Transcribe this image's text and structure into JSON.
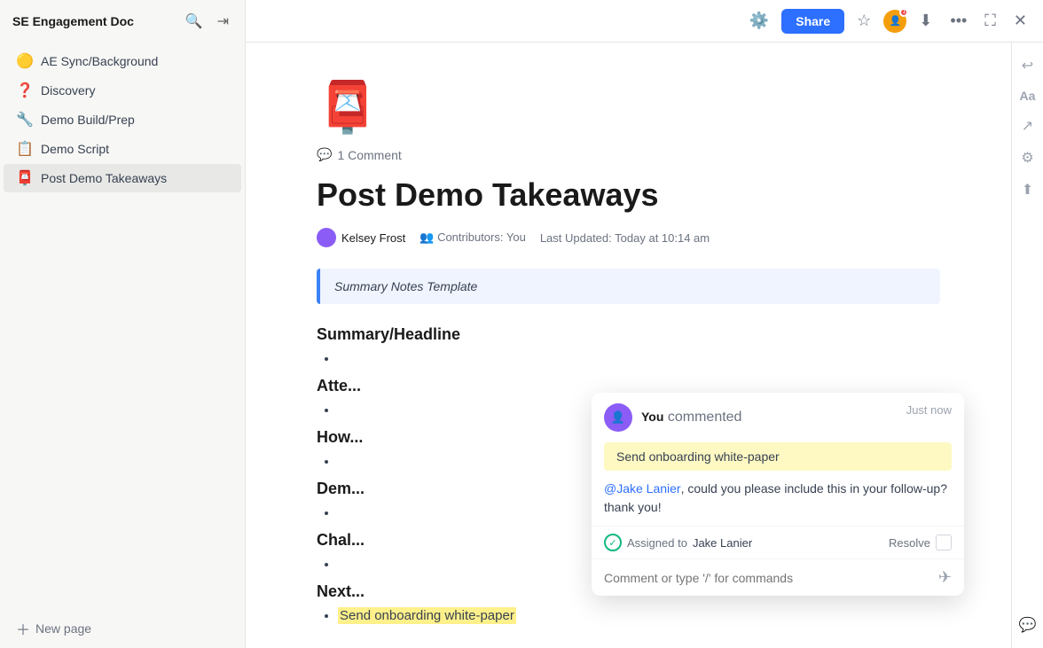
{
  "sidebar": {
    "title": "SE Engagement Doc",
    "items": [
      {
        "id": "ae-sync",
        "icon": "🟡",
        "label": "AE Sync/Background",
        "active": false
      },
      {
        "id": "discovery",
        "icon": "❓",
        "label": "Discovery",
        "active": false
      },
      {
        "id": "demo-build",
        "icon": "🔧",
        "label": "Demo Build/Prep",
        "active": false
      },
      {
        "id": "demo-script",
        "icon": "📋",
        "label": "Demo Script",
        "active": false
      },
      {
        "id": "post-demo",
        "icon": "📮",
        "label": "Post Demo Takeaways",
        "active": true
      }
    ],
    "new_page_label": "New page"
  },
  "topbar": {
    "share_label": "Share"
  },
  "doc": {
    "emoji": "📮",
    "comment_count": "1 Comment",
    "title": "Post Demo Takeaways",
    "author": "Kelsey Frost",
    "contributors_label": "Contributors:",
    "contributors_value": "You",
    "last_updated_label": "Last Updated:",
    "last_updated_value": "Today at 10:14 am",
    "summary_block": "Summary Notes Template",
    "sections": [
      {
        "title": "Summary/Headline"
      },
      {
        "title": "Atte..."
      },
      {
        "title": "How..."
      },
      {
        "title": "Dem..."
      },
      {
        "title": "Chal..."
      },
      {
        "title": "Next..."
      }
    ],
    "highlighted_item": "Send onboarding white-paper"
  },
  "comment_popup": {
    "author": "You",
    "author_action": "commented",
    "time": "Just now",
    "highlighted_text": "Send onboarding white-paper",
    "body_mention": "@Jake Lanier",
    "body_text": ", could you please include this in your follow-up? thank you!",
    "assigned_label": "Assigned to",
    "assigned_name": "Jake Lanier",
    "resolve_label": "Resolve",
    "input_placeholder": "Comment or type '/' for commands"
  }
}
